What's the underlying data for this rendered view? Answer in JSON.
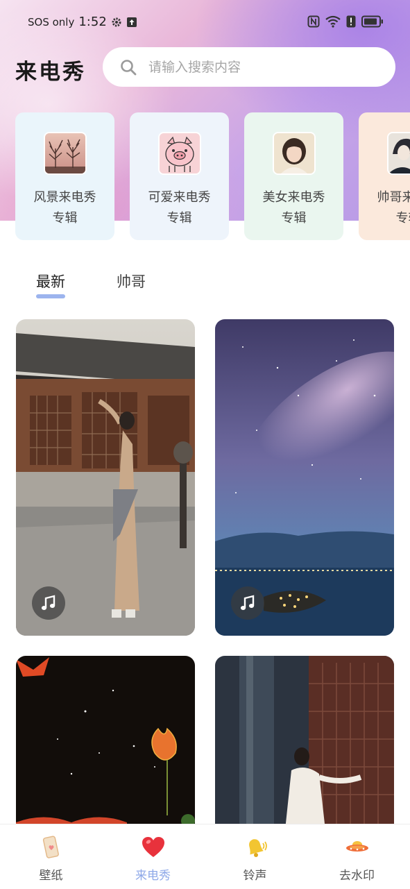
{
  "status_bar": {
    "carrier": "SOS only",
    "time": "1:52"
  },
  "header": {
    "title": "来电秀",
    "search_placeholder": "请输入搜索内容"
  },
  "albums": [
    {
      "name": "风景来电秀",
      "sub": "专辑",
      "bg": "#eaf5fb",
      "thumb": "tree-photo"
    },
    {
      "name": "可爱来电秀",
      "sub": "专辑",
      "bg": "#eef4fb",
      "thumb": "pig-cartoon"
    },
    {
      "name": "美女来电秀",
      "sub": "专辑",
      "bg": "#eaf6ef",
      "thumb": "girl-portrait"
    },
    {
      "name": "帅哥来电秀",
      "sub": "专辑",
      "bg": "#fbe9dc",
      "thumb": "anime-boys"
    }
  ],
  "tabs": [
    {
      "label": "最新",
      "active": true
    },
    {
      "label": "帅哥",
      "active": false
    }
  ],
  "grid": [
    {
      "name": "woman-courtyard",
      "has_music": true
    },
    {
      "name": "starry-night-lake",
      "has_music": true
    },
    {
      "name": "moon-lotus",
      "has_music": false
    },
    {
      "name": "woman-temple",
      "has_music": false
    }
  ],
  "bottom_nav": [
    {
      "label": "壁纸",
      "icon": "wallpaper-icon",
      "active": false
    },
    {
      "label": "来电秀",
      "icon": "heart-icon",
      "active": true
    },
    {
      "label": "铃声",
      "icon": "bell-icon",
      "active": false
    },
    {
      "label": "去水印",
      "icon": "ufo-icon",
      "active": false
    }
  ],
  "colors": {
    "accent": "#8ea8e8",
    "tab_underline": "#9cb4ee"
  }
}
